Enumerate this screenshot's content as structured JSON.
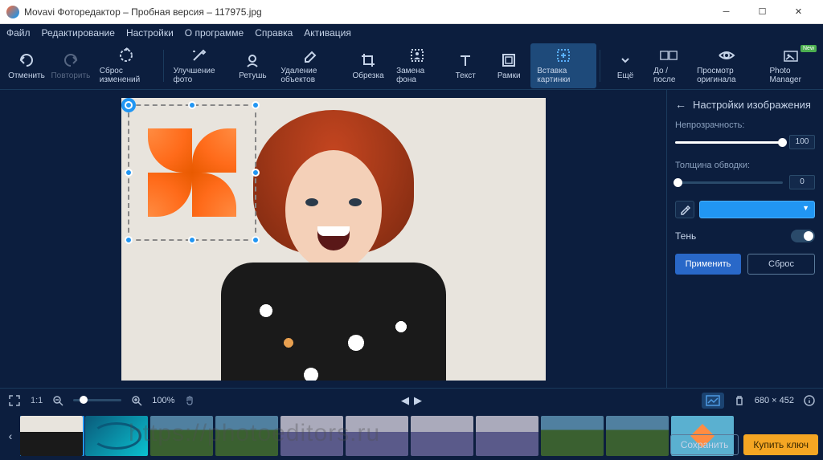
{
  "titlebar": {
    "text": "Movavi Фоторедактор – Пробная версия – 117975.jpg"
  },
  "menu": {
    "file": "Файл",
    "edit": "Редактирование",
    "settings": "Настройки",
    "about": "О программе",
    "help": "Справка",
    "activation": "Активация"
  },
  "tools": {
    "undo": "Отменить",
    "redo": "Повторить",
    "reset": "Сброс изменений",
    "enhance": "Улучшение фото",
    "retouch": "Ретушь",
    "remove": "Удаление объектов",
    "crop": "Обрезка",
    "bgswap": "Замена фона",
    "text": "Текст",
    "frames": "Рамки",
    "insert": "Вставка картинки",
    "more": "Ещё",
    "beforeafter": "До / после",
    "vieworiginal": "Просмотр оригинала",
    "photomanager": "Photo Manager",
    "new_badge": "New"
  },
  "sidebar": {
    "title": "Настройки изображения",
    "opacity_label": "Непрозрачность:",
    "opacity_value": "100",
    "stroke_label": "Толщина обводки:",
    "stroke_value": "0",
    "shadow_label": "Тень",
    "apply": "Применить",
    "reset": "Сброс"
  },
  "bottombar": {
    "ratio": "1:1",
    "zoom": "100%",
    "dimensions": "680 × 452"
  },
  "watermark": "https://photoeditors.ru",
  "actions": {
    "save": "Сохранить",
    "buy": "Купить ключ"
  }
}
